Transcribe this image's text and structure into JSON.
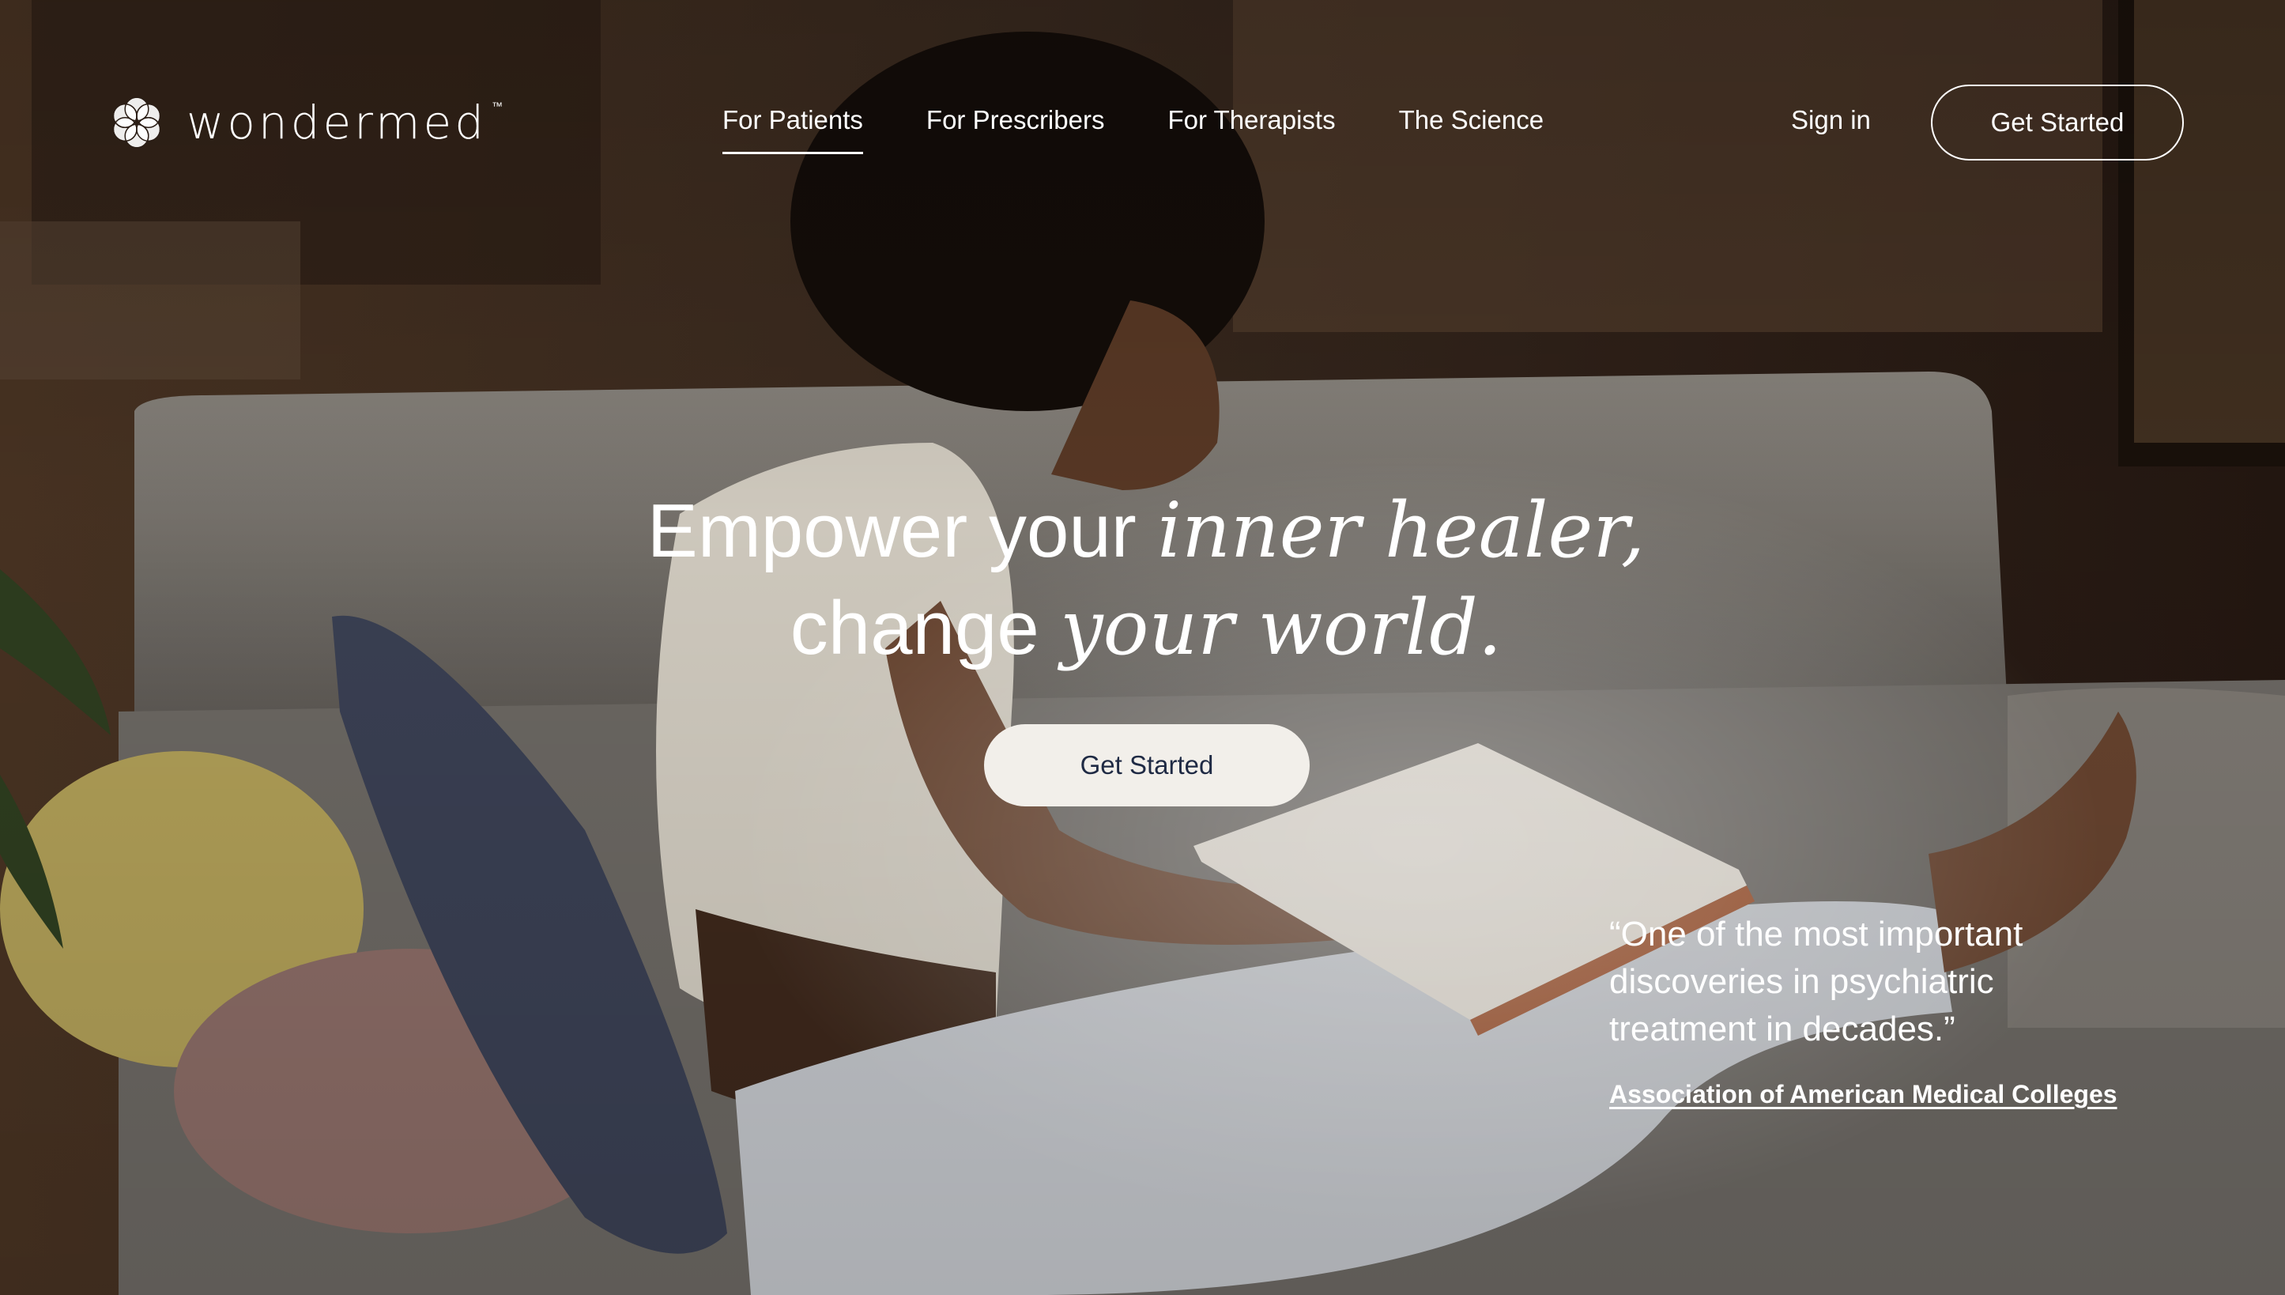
{
  "brand": {
    "name": "wondermed",
    "trademark": "™"
  },
  "nav": {
    "items": [
      {
        "label": "For Patients",
        "active": true
      },
      {
        "label": "For Prescribers",
        "active": false
      },
      {
        "label": "For Therapists",
        "active": false
      },
      {
        "label": "The Science",
        "active": false
      }
    ],
    "sign_in_label": "Sign in",
    "cta_label": "Get Started"
  },
  "hero": {
    "headline_part1": "Empower your ",
    "headline_part2": "inner healer,",
    "headline_part3": "change ",
    "headline_part4": "your world.",
    "cta_label": "Get Started"
  },
  "testimonial": {
    "quote": "“One of the most important discoveries in psychiatric treatment in decades.”",
    "source": "Association of American Medical Colleges"
  },
  "colors": {
    "text": "#ffffff",
    "cta_background": "#f2efea",
    "cta_text": "#1f2a44"
  },
  "icons": {
    "logo": "flower-of-life-icon"
  }
}
